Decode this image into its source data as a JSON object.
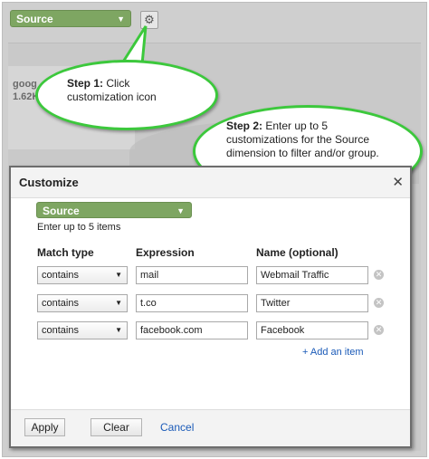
{
  "background": {
    "source_label": "Source",
    "card_line1": "goog",
    "card_line2": "1.62K"
  },
  "callouts": {
    "step1_label": "Step 1:",
    "step1_text": " Click customization icon",
    "step2_label": "Step 2:",
    "step2_text": " Enter up to 5 customizations for the Source dimension to filter and/or group."
  },
  "dialog": {
    "title": "Customize",
    "close_symbol": "✕",
    "dimension_label": "Source",
    "hint": "Enter up to 5 items",
    "headers": {
      "match": "Match type",
      "expression": "Expression",
      "name": "Name (optional)"
    },
    "rows": [
      {
        "match": "contains",
        "expression": "mail",
        "name": "Webmail Traffic"
      },
      {
        "match": "contains",
        "expression": "t.co",
        "name": "Twitter"
      },
      {
        "match": "contains",
        "expression": "facebook.com",
        "name": "Facebook"
      }
    ],
    "add_item": "+ Add an item",
    "apply": "Apply",
    "clear": "Clear",
    "cancel": "Cancel"
  },
  "colors": {
    "accent_green": "#7ea662",
    "callout_border": "#3cc83c",
    "link_blue": "#1a5ab8"
  },
  "icons": {
    "gear": "gear-icon",
    "remove": "remove-circle-icon",
    "dropdown": "chevron-down-icon"
  }
}
